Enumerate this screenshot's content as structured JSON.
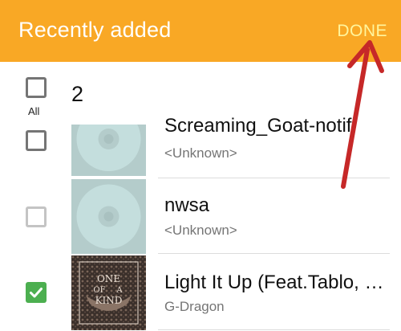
{
  "appbar": {
    "title": "Recently added",
    "done_label": "DONE",
    "background_color": "#f9a825",
    "done_color": "#fff59d"
  },
  "select_all": {
    "label": "All",
    "selected_count": "2",
    "checked": false
  },
  "tracks": [
    {
      "title": "Screaming_Goat-notifi",
      "subtitle": "<Unknown>",
      "checked": false,
      "art": "default-disc-icon"
    },
    {
      "title": "nwsa",
      "subtitle": "<Unknown>",
      "checked": false,
      "art": "default-disc-icon"
    },
    {
      "title": "Light It Up (Feat.Tablo, …",
      "subtitle": "G-Dragon",
      "checked": true,
      "art": "album-cover-one-of-a-kind",
      "art_text": [
        "ONE",
        "OF",
        "A",
        "KIND"
      ]
    }
  ],
  "annotation": {
    "icon": "red-arrow-pointing-to-done",
    "color": "#c62828"
  },
  "check_color": "#4caf50"
}
